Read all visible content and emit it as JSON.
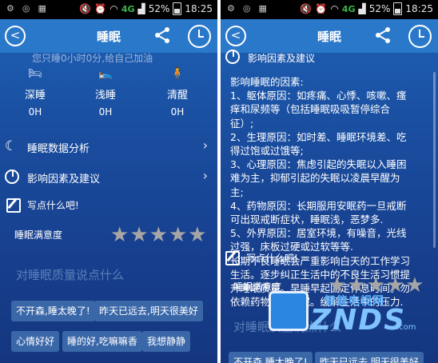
{
  "status": {
    "battery": "52%",
    "time": "18:25",
    "network": "4G"
  },
  "app": {
    "title": "睡眠"
  },
  "left": {
    "faded_text": "您只睡0小时0分,给自己加油",
    "stats": [
      {
        "label": "深睡",
        "value": "0H"
      },
      {
        "label": "浅睡",
        "value": "0H"
      },
      {
        "label": "清醒",
        "value": "0H"
      }
    ],
    "menu": [
      {
        "label": "睡眠数据分析"
      },
      {
        "label": "影响因素及建议"
      }
    ],
    "write_label": "写点什么吧!",
    "satisfaction_label": "睡眠满意度",
    "rating": 0,
    "placeholder": "对睡眠质量说点什么",
    "chips": [
      "不开森,睡太晚了!",
      "昨天已远去,明天很美好",
      "心情好好",
      "睡的好,吃嘛嘛香",
      "我想静静"
    ]
  },
  "right": {
    "section_label": "影响因素及建议",
    "paragraphs": [
      "影响睡眠的因素:",
      "1、躯体原因：如疼痛、心悸、咳嗽、瘙痒和尿频等（包括睡眠吸吸暂停综合征）;",
      "2、生理原因：如时差、睡眠环境差、吃得过饱或过饿等;",
      "3、心理原因：焦虑引起的失眠以入睡困难为主，抑郁引起的失眠以凌晨早醒为主;",
      "4、药物原因：长期服用安眠药一旦戒断可出现戒断症状，睡眠浅，恶梦多.",
      "5、外界原因：居室环境，有噪音，光线过强，床板过硬或过软等等.",
      "长期不良睡眠会严重影响白天的工作学习生活。逐步纠正生活中的不良生活习惯提升睡眠质量。早睡早起固定作息时间。勿依赖药物改善睡眠。缓解生活中的压力."
    ],
    "write_label": "写点什么吧!",
    "satisfaction_label": "睡眠满意度",
    "rating": 0,
    "placeholder": "对睡眠质量说点什么",
    "chips": [
      "不开森,睡太晚了!",
      "昨天已远去,明天很美好"
    ]
  },
  "watermark": {
    "cn": "智能电视网",
    "en": "ZNDS",
    "com": ".com"
  },
  "colors": {
    "accent": "#2a78c9",
    "star_off": "#a6a6a6",
    "chip": "#3a67a8"
  }
}
